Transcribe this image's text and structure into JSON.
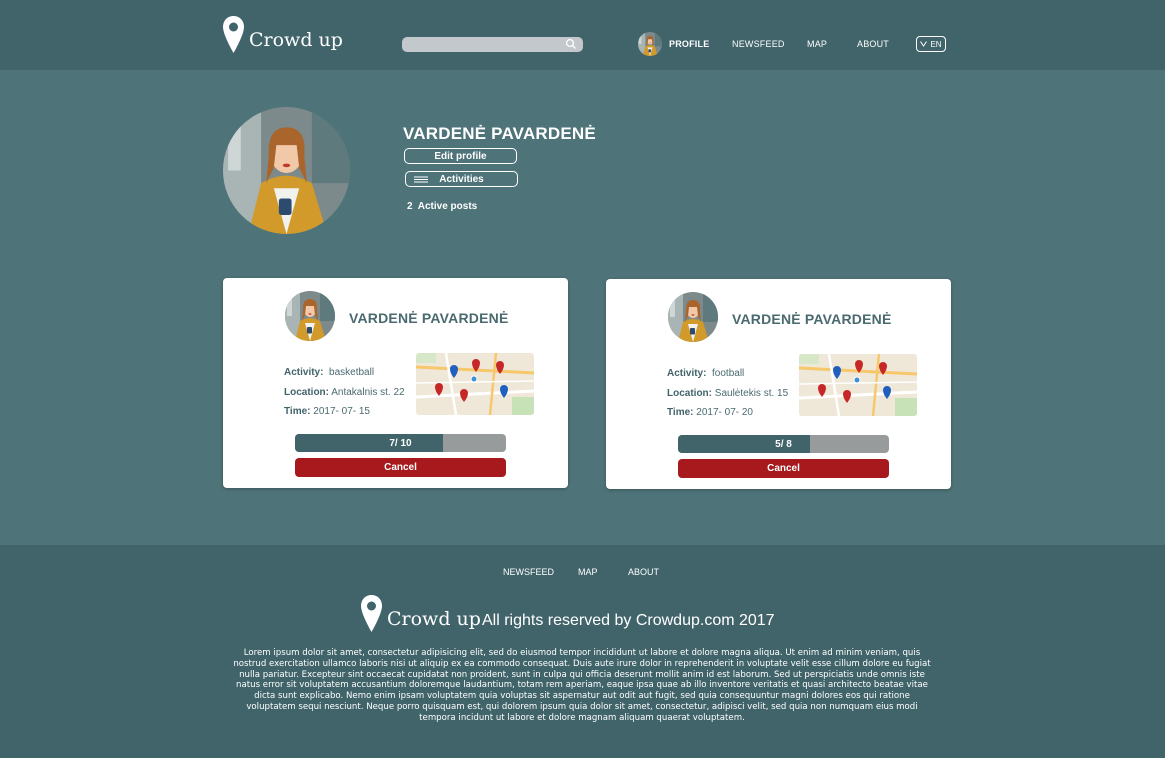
{
  "colors": {
    "header_bg": "#41646b",
    "page_bg": "#4e7378",
    "accent_red": "#a7191c",
    "progress_fill": "#41646b",
    "progress_track": "#979b9c",
    "card_bg": "#ffffff"
  },
  "header": {
    "logo_text": "Crowd up",
    "search_placeholder": "",
    "nav": {
      "profile": "PROFILE",
      "newsfeed": "NEWSFEED",
      "map": "MAP",
      "about": "ABOUT"
    },
    "language": "EN"
  },
  "profile": {
    "name": "VARDENĖ PAVARDENĖ",
    "edit_profile_label": "Edit profile",
    "activities_label": "Activities",
    "active_posts_count": "2",
    "active_posts_label": "Active posts"
  },
  "posts": [
    {
      "name": "VARDENĖ PAVARDENĖ",
      "activity_label": "Activity:",
      "activity": "basketball",
      "location_label": "Location:",
      "location": "Antakalnis st. 22",
      "time_label": "Time:",
      "time": "2017- 07- 15",
      "progress_text": "7/ 10",
      "progress_fraction": 0.7,
      "cancel_label": "Cancel"
    },
    {
      "name": "VARDENĖ PAVARDENĖ",
      "activity_label": "Activity:",
      "activity": "football",
      "location_label": "Location:",
      "location": "Saulėtekis st. 15",
      "time_label": "Time:",
      "time": "2017- 07- 20",
      "progress_text": "5/ 8",
      "progress_fraction": 0.625,
      "cancel_label": "Cancel"
    }
  ],
  "footer": {
    "nav": {
      "newsfeed": "NEWSFEED",
      "map": "MAP",
      "about": "ABOUT"
    },
    "logo_text": "Crowd up",
    "copyright": "All rights reserved by Crowdup.com 2017",
    "lorem": "Lorem ipsum dolor sit amet, consectetur adipisicing elit, sed do eiusmod tempor incididunt ut labore et dolore magna aliqua. Ut enim ad minim veniam, quis nostrud exercitation ullamco laboris nisi ut aliquip ex ea commodo consequat. Duis aute irure dolor in reprehenderit in voluptate velit esse cillum dolore eu fugiat nulla pariatur. Excepteur sint occaecat cupidatat non proident, sunt in culpa qui officia deserunt mollit anim id est laborum. Sed ut perspiciatis unde omnis iste natus error sit voluptatem accusantium doloremque laudantium, totam rem aperiam, eaque ipsa quae ab illo inventore veritatis et quasi architecto beatae vitae dicta sunt explicabo. Nemo enim ipsam voluptatem quia voluptas sit aspernatur aut odit aut fugit, sed quia consequuntur magni dolores eos qui ratione voluptatem sequi nesciunt. Neque porro quisquam est, qui dolorem ipsum quia dolor sit amet, consectetur, adipisci velit, sed quia non numquam eius modi tempora incidunt ut labore et dolore magnam aliquam quaerat voluptatem."
  }
}
